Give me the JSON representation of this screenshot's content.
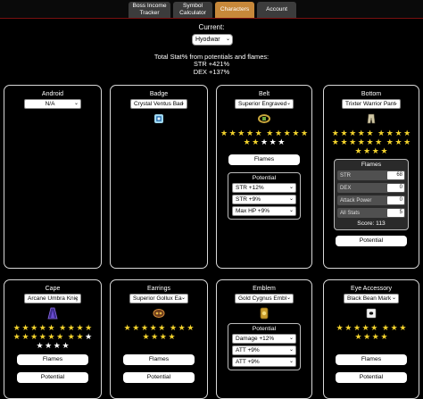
{
  "tabs": [
    "Boss Income Tracker",
    "Symbol Calculator",
    "Characters",
    "Account"
  ],
  "active_tab": "Characters",
  "current_label": "Current:",
  "character": "Hyodwar",
  "totals": {
    "heading": "Total Stat% from potentials and flames:",
    "str": "STR +421%",
    "dex": "DEX +137%"
  },
  "colors": {
    "active_tab": "#c7883a",
    "star_filled": "#f2d22c",
    "star_empty": "#ffffff",
    "accent_line": "#7a1010"
  },
  "labels": {
    "flames": "Flames",
    "potential": "Potential"
  },
  "cards": {
    "android": {
      "title": "Android",
      "selected": "N/A"
    },
    "badge": {
      "title": "Badge",
      "selected": "Crystal Ventus Bad",
      "icon": "badge-icon"
    },
    "belt": {
      "title": "Belt",
      "selected": "Superior Engraved",
      "icon": "belt-icon",
      "stars_filled": 12,
      "stars_total": 15,
      "potential": {
        "title": "Potential",
        "lines": [
          "STR +12%",
          "STR +9%",
          "Max HP +9%"
        ]
      }
    },
    "bottom": {
      "title": "Bottom",
      "selected": "Trixter Warrior Pant",
      "icon": "pants-icon",
      "stars_filled": 22,
      "stars_total": 22,
      "flames": {
        "title": "Flames",
        "rows": [
          {
            "label": "STR",
            "value": "68"
          },
          {
            "label": "DEX",
            "value": "0"
          },
          {
            "label": "Attack Power",
            "value": "0"
          },
          {
            "label": "All Stats",
            "value": "5"
          }
        ],
        "score": "Score: 113"
      }
    },
    "cape": {
      "title": "Cape",
      "selected": "Arcane Umbra Kniç",
      "icon": "cape-icon",
      "stars_filled": 17,
      "stars_total": 22
    },
    "earrings": {
      "title": "Earrings",
      "selected": "Superior Gollux Ea",
      "icon": "earrings-icon",
      "stars_filled": 12,
      "stars_total": 12
    },
    "emblem": {
      "title": "Emblem",
      "selected": "Gold Cygnus Embl",
      "icon": "emblem-icon",
      "potential": {
        "title": "Potential",
        "lines": [
          "Damage +12%",
          "ATT +9%",
          "ATT +9%"
        ]
      }
    },
    "eye": {
      "title": "Eye Accessory",
      "selected": "Black Bean Mark",
      "icon": "eye-accessory-icon",
      "stars_filled": 12,
      "stars_total": 12
    }
  }
}
